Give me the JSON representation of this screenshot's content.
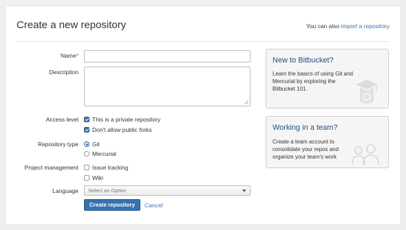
{
  "header": {
    "title": "Create a new repository",
    "import_prefix": "You can also",
    "import_link": "import a repository"
  },
  "form": {
    "name_label": "Name",
    "name_required": "*",
    "name_value": "",
    "description_label": "Description",
    "description_value": "",
    "access_level_label": "Access level",
    "private_label": "This is a private repository",
    "private_checked": true,
    "forks_label": "Don't allow public forks",
    "forks_checked": true,
    "repo_type_label": "Repository type",
    "git_label": "Git",
    "mercurial_label": "Mercurial",
    "selected_type": "Git",
    "project_mgmt_label": "Project management",
    "issue_tracking_label": "Issue tracking",
    "wiki_label": "Wiki",
    "language_label": "Language",
    "language_placeholder": "Select an Option",
    "submit_label": "Create repository",
    "cancel_label": "Cancel"
  },
  "sidebar": {
    "card1_title": "New to Bitbucket?",
    "card1_body": "Learn the basics of using Git and Mercurial by exploring the Bitbucket 101.",
    "card1_icon": "graduation-cap-icon",
    "card2_title": "Working in a team?",
    "card2_body": "Create a team account to consolidate your repos and organize your team's work",
    "card2_icon": "team-icon"
  },
  "colors": {
    "accent": "#3572b0",
    "card_title": "#205081",
    "required": "#d04437"
  }
}
